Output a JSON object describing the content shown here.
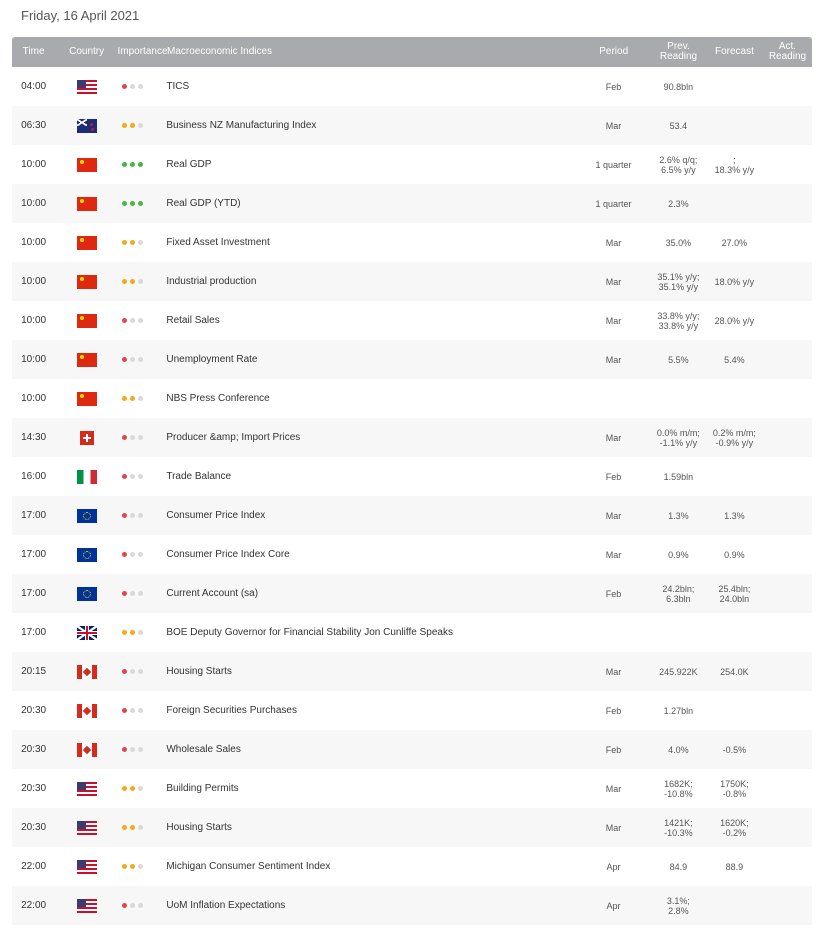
{
  "date_title": "Friday, 16 April 2021",
  "columns": {
    "time": "Time",
    "country": "Country",
    "importance": "Importance",
    "indices": "Macroeconomic Indices",
    "period": "Period",
    "prev": [
      "Prev.",
      "Reading"
    ],
    "forecast": "Forecast",
    "actual": [
      "Act.",
      "Reading"
    ]
  },
  "importance_colors": {
    "low": "#e0474c",
    "medium": "#f4a81d",
    "high": "#49b748",
    "off": "#d9d9d9"
  },
  "rows": [
    {
      "time": "04:00",
      "country": "us-flag-icon",
      "importance": 1,
      "name": "TICS",
      "period": "Feb",
      "prev": [
        "90.8bln"
      ],
      "forecast": [],
      "actual": []
    },
    {
      "time": "06:30",
      "country": "nz-flag-icon",
      "importance": 2,
      "name": "Business NZ Manufacturing Index",
      "period": "Mar",
      "prev": [
        "53.4"
      ],
      "forecast": [],
      "actual": []
    },
    {
      "time": "10:00",
      "country": "cn-flag-icon",
      "importance": 3,
      "name": "Real GDP",
      "period": "1 quarter",
      "prev": [
        "2.6% q/q;",
        "6.5% y/y"
      ],
      "forecast": [
        ";",
        "18.3% y/y"
      ],
      "actual": []
    },
    {
      "time": "10:00",
      "country": "cn-flag-icon",
      "importance": 3,
      "name": "Real GDP (YTD)",
      "period": "1 quarter",
      "prev": [
        "2.3%"
      ],
      "forecast": [],
      "actual": []
    },
    {
      "time": "10:00",
      "country": "cn-flag-icon",
      "importance": 2,
      "name": "Fixed Asset Investment",
      "period": "Mar",
      "prev": [
        "35.0%"
      ],
      "forecast": [
        "27.0%"
      ],
      "actual": []
    },
    {
      "time": "10:00",
      "country": "cn-flag-icon",
      "importance": 2,
      "name": "Industrial production",
      "period": "Mar",
      "prev": [
        "35.1% y/y;",
        "35.1% y/y"
      ],
      "forecast": [
        "18.0% y/y"
      ],
      "actual": []
    },
    {
      "time": "10:00",
      "country": "cn-flag-icon",
      "importance": 1,
      "name": "Retail Sales",
      "period": "Mar",
      "prev": [
        "33.8% y/y;",
        "33.8% y/y"
      ],
      "forecast": [
        "28.0% y/y"
      ],
      "actual": []
    },
    {
      "time": "10:00",
      "country": "cn-flag-icon",
      "importance": 1,
      "name": "Unemployment Rate",
      "period": "Mar",
      "prev": [
        "5.5%"
      ],
      "forecast": [
        "5.4%"
      ],
      "actual": []
    },
    {
      "time": "10:00",
      "country": "cn-flag-icon",
      "importance": 2,
      "name": "NBS Press Conference",
      "period": "",
      "prev": [],
      "forecast": [],
      "actual": []
    },
    {
      "time": "14:30",
      "country": "ch-flag-icon",
      "importance": 1,
      "name": "Producer &amp; Import Prices",
      "period": "Mar",
      "prev": [
        "0.0% m/m;",
        "-1.1% y/y"
      ],
      "forecast": [
        "0.2% m/m;",
        "-0.9% y/y"
      ],
      "actual": []
    },
    {
      "time": "16:00",
      "country": "it-flag-icon",
      "importance": 1,
      "name": "Trade Balance",
      "period": "Feb",
      "prev": [
        "1.59bln"
      ],
      "forecast": [],
      "actual": []
    },
    {
      "time": "17:00",
      "country": "eu-flag-icon",
      "importance": 1,
      "name": "Consumer Price Index",
      "period": "Mar",
      "prev": [
        "1.3%"
      ],
      "forecast": [
        "1.3%"
      ],
      "actual": []
    },
    {
      "time": "17:00",
      "country": "eu-flag-icon",
      "importance": 1,
      "name": "Consumer Price Index Core",
      "period": "Mar",
      "prev": [
        "0.9%"
      ],
      "forecast": [
        "0.9%"
      ],
      "actual": []
    },
    {
      "time": "17:00",
      "country": "eu-flag-icon",
      "importance": 1,
      "name": "Current Account (sa)",
      "period": "Feb",
      "prev": [
        "24.2bln;",
        "6.3bln"
      ],
      "forecast": [
        "25.4bln;",
        "24.0bln"
      ],
      "actual": []
    },
    {
      "time": "17:00",
      "country": "gb-flag-icon",
      "importance": 2,
      "name": "BOE Deputy Governor for Financial Stability Jon Cunliffe Speaks",
      "period": "",
      "prev": [],
      "forecast": [],
      "actual": []
    },
    {
      "time": "20:15",
      "country": "ca-flag-icon",
      "importance": 1,
      "name": "Housing Starts",
      "period": "Mar",
      "prev": [
        "245.922K"
      ],
      "forecast": [
        "254.0K"
      ],
      "actual": []
    },
    {
      "time": "20:30",
      "country": "ca-flag-icon",
      "importance": 1,
      "name": "Foreign Securities Purchases",
      "period": "Feb",
      "prev": [
        "1.27bln"
      ],
      "forecast": [],
      "actual": []
    },
    {
      "time": "20:30",
      "country": "ca-flag-icon",
      "importance": 1,
      "name": "Wholesale Sales",
      "period": "Feb",
      "prev": [
        "4.0%"
      ],
      "forecast": [
        "-0.5%"
      ],
      "actual": []
    },
    {
      "time": "20:30",
      "country": "us-flag-icon",
      "importance": 2,
      "name": "Building Permits",
      "period": "Mar",
      "prev": [
        "1682K;",
        "-10.8%"
      ],
      "forecast": [
        "1750K;",
        "-0.8%"
      ],
      "actual": []
    },
    {
      "time": "20:30",
      "country": "us-flag-icon",
      "importance": 2,
      "name": "Housing Starts",
      "period": "Mar",
      "prev": [
        "1421K;",
        "-10.3%"
      ],
      "forecast": [
        "1620K;",
        "-0.2%"
      ],
      "actual": []
    },
    {
      "time": "22:00",
      "country": "us-flag-icon",
      "importance": 2,
      "name": "Michigan Consumer Sentiment Index",
      "period": "Apr",
      "prev": [
        "84.9"
      ],
      "forecast": [
        "88.9"
      ],
      "actual": []
    },
    {
      "time": "22:00",
      "country": "us-flag-icon",
      "importance": 1,
      "name": "UoM Inflation Expectations",
      "period": "Apr",
      "prev": [
        "3.1%;",
        "2.8%"
      ],
      "forecast": [],
      "actual": []
    }
  ]
}
